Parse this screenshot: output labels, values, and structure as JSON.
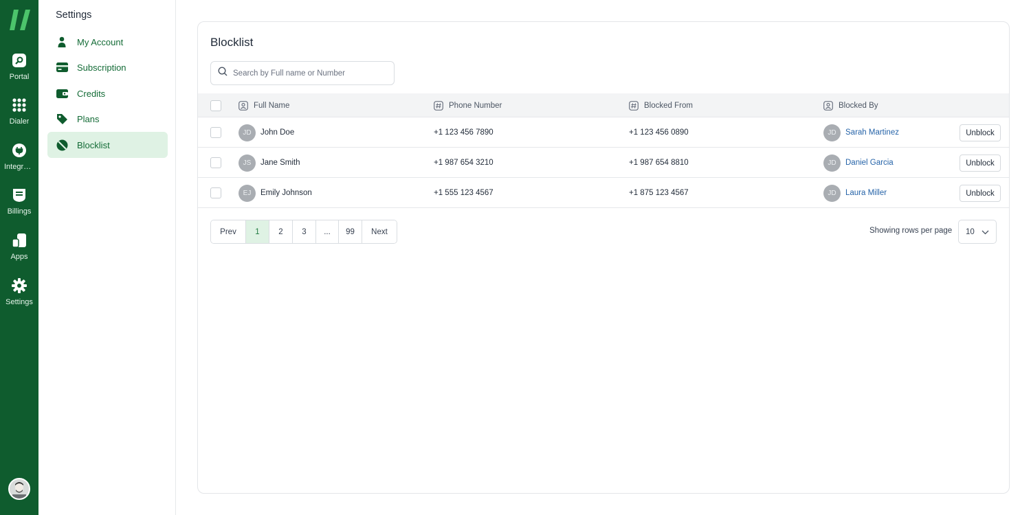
{
  "rail": {
    "items": [
      {
        "label": "Portal",
        "icon": "portal-icon"
      },
      {
        "label": "Dialer",
        "icon": "dialer-grid-icon"
      },
      {
        "label": "Integrations",
        "icon": "integrations-plug-icon"
      },
      {
        "label": "Billings",
        "icon": "billing-icon"
      },
      {
        "label": "Apps",
        "icon": "apps-icon"
      },
      {
        "label": "Settings",
        "icon": "gear-icon"
      }
    ]
  },
  "sidebar": {
    "title": "Settings",
    "items": [
      {
        "label": "My Account",
        "icon": "user-icon"
      },
      {
        "label": "Subscription",
        "icon": "card-icon"
      },
      {
        "label": "Credits",
        "icon": "wallet-icon"
      },
      {
        "label": "Plans",
        "icon": "tag-icon"
      },
      {
        "label": "Blocklist",
        "icon": "block-icon",
        "active": true
      }
    ]
  },
  "main": {
    "title": "Blocklist",
    "search_placeholder": "Search by Full name or Number",
    "columns": {
      "full_name": "Full Name",
      "phone_number": "Phone Number",
      "blocked_from": "Blocked From",
      "blocked_by": "Blocked By"
    },
    "rows": [
      {
        "initials": "JD",
        "name": "John Doe",
        "phone": "+1 123 456 7890",
        "from": "+1 123 456 0890",
        "by_initials": "JD",
        "by": "Sarah Martinez",
        "action": "Unblock"
      },
      {
        "initials": "JS",
        "name": "Jane Smith",
        "phone": "+1 987 654 3210",
        "from": "+1 987 654 8810",
        "by_initials": "JD",
        "by": "Daniel Garcia",
        "action": "Unblock"
      },
      {
        "initials": "EJ",
        "name": "Emily Johnson",
        "phone": "+1 555 123 4567",
        "from": "+1 875 123 4567",
        "by_initials": "JD",
        "by": "Laura Miller",
        "action": "Unblock"
      }
    ],
    "pagination": {
      "prev": "Prev",
      "pages": [
        "1",
        "2",
        "3",
        "...",
        "99"
      ],
      "current": "1",
      "next": "Next"
    },
    "rows_per_page_label": "Showing rows per page",
    "rows_per_page_value": "10"
  },
  "colors": {
    "brand_dark": "#0f5c2e",
    "accent_green": "#136b36",
    "active_bg": "#dff2e4",
    "link_blue": "#2563a8"
  }
}
